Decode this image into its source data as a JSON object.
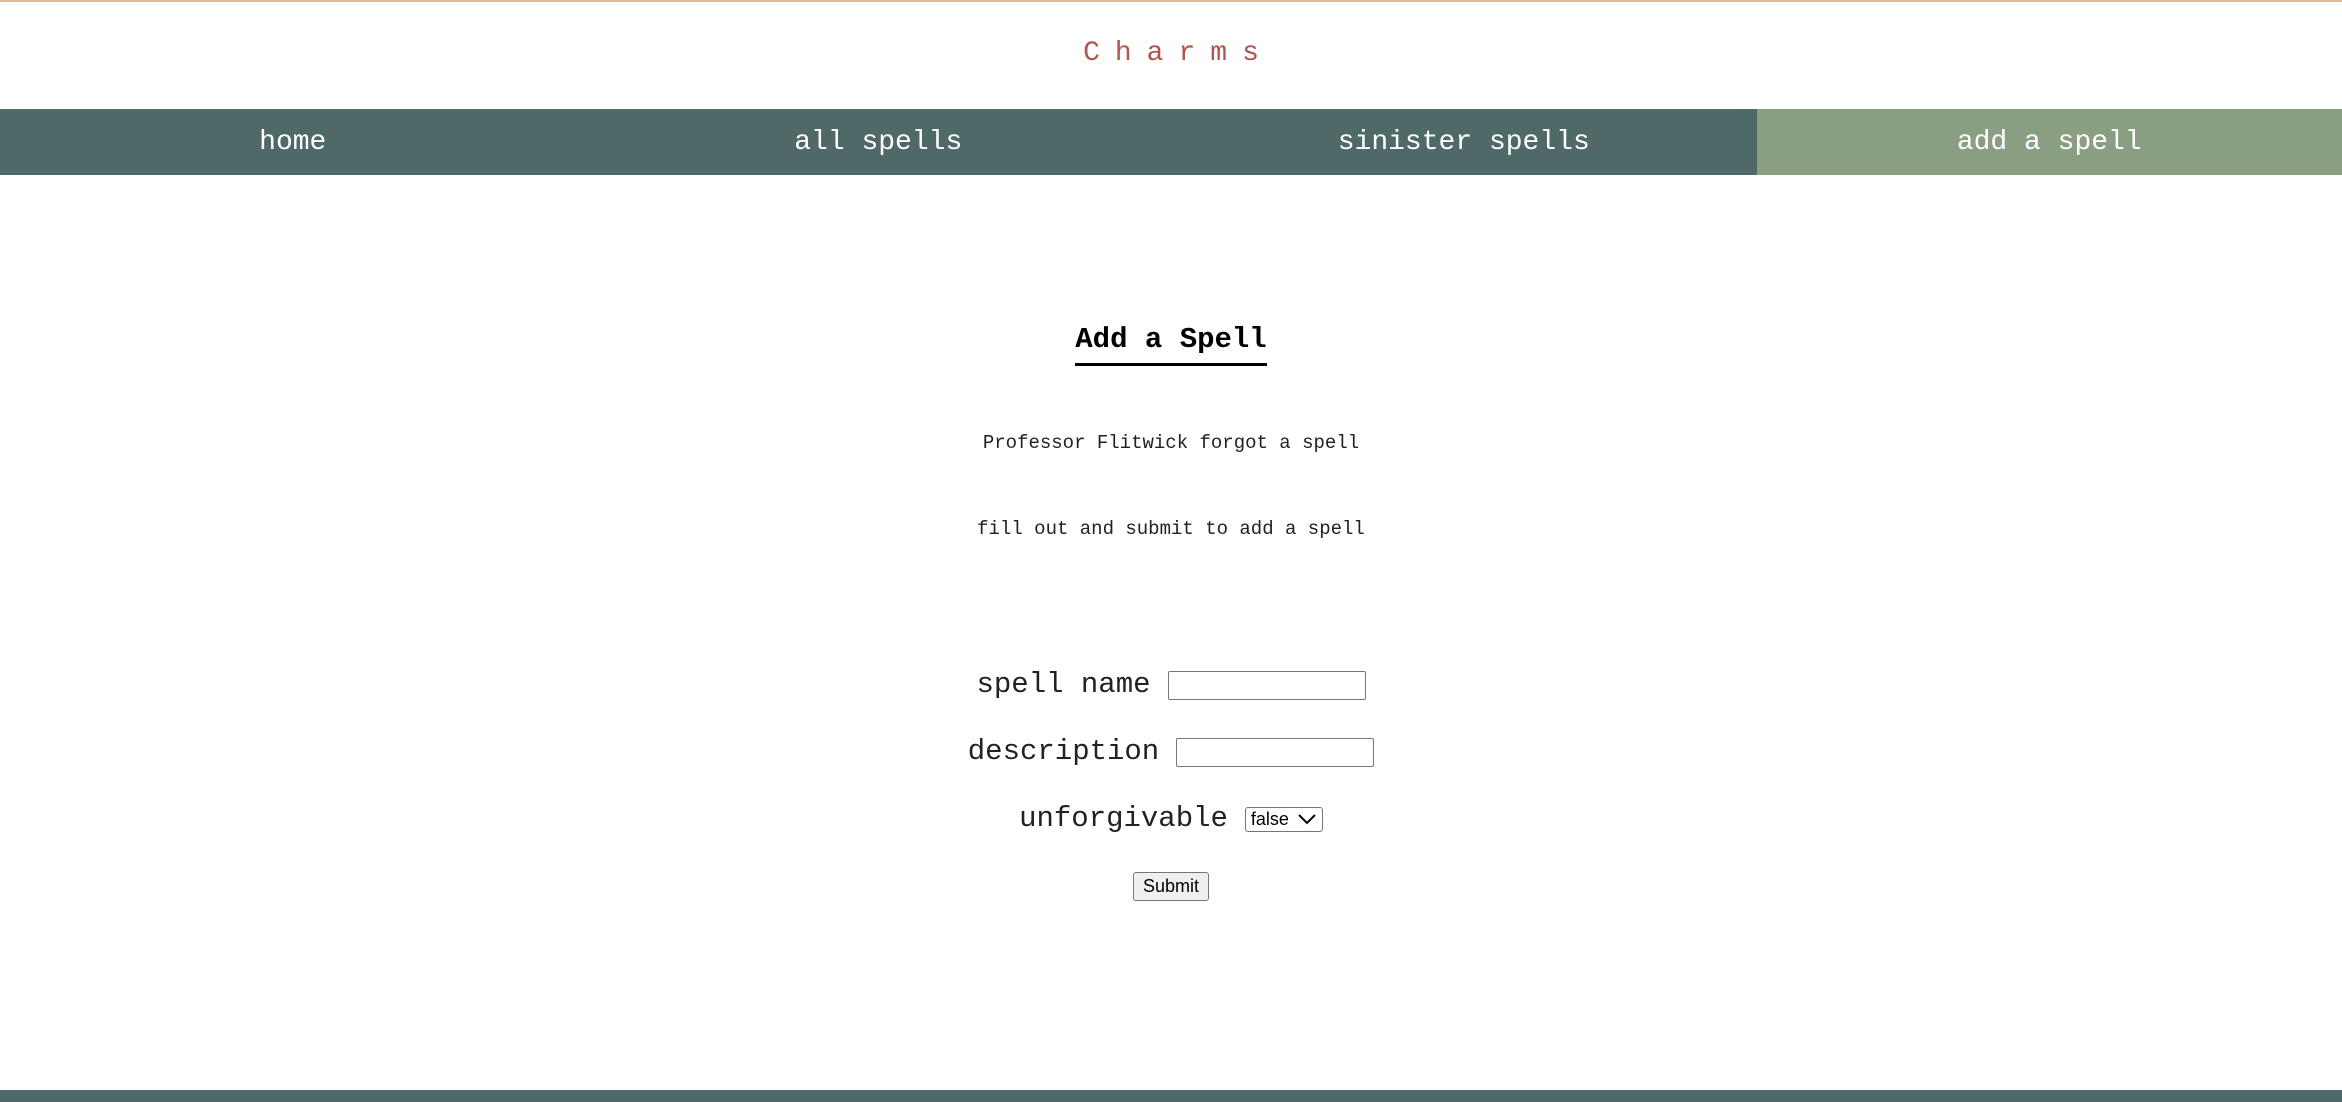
{
  "site": {
    "title": "Charms"
  },
  "nav": {
    "items": [
      {
        "label": "home",
        "active": false
      },
      {
        "label": "all spells",
        "active": false
      },
      {
        "label": "sinister spells",
        "active": false
      },
      {
        "label": "add a spell",
        "active": true
      }
    ]
  },
  "main": {
    "heading": "Add a Spell",
    "intro_1": "Professor Flitwick forgot a spell",
    "intro_2": "fill out and submit to add a spell"
  },
  "form": {
    "spell_name": {
      "label": "spell name",
      "value": ""
    },
    "description": {
      "label": "description",
      "value": ""
    },
    "unforgivable": {
      "label": "unforgivable",
      "selected": "false"
    },
    "submit_label": "Submit"
  },
  "icons": {
    "select_arrow": "chevron-down-icon"
  },
  "colors": {
    "nav_background": "#4f6969",
    "nav_active_background": "#8a9e82",
    "site_title": "#b5524a",
    "top_border": "#e0b89c",
    "footer": "#4f6969"
  }
}
